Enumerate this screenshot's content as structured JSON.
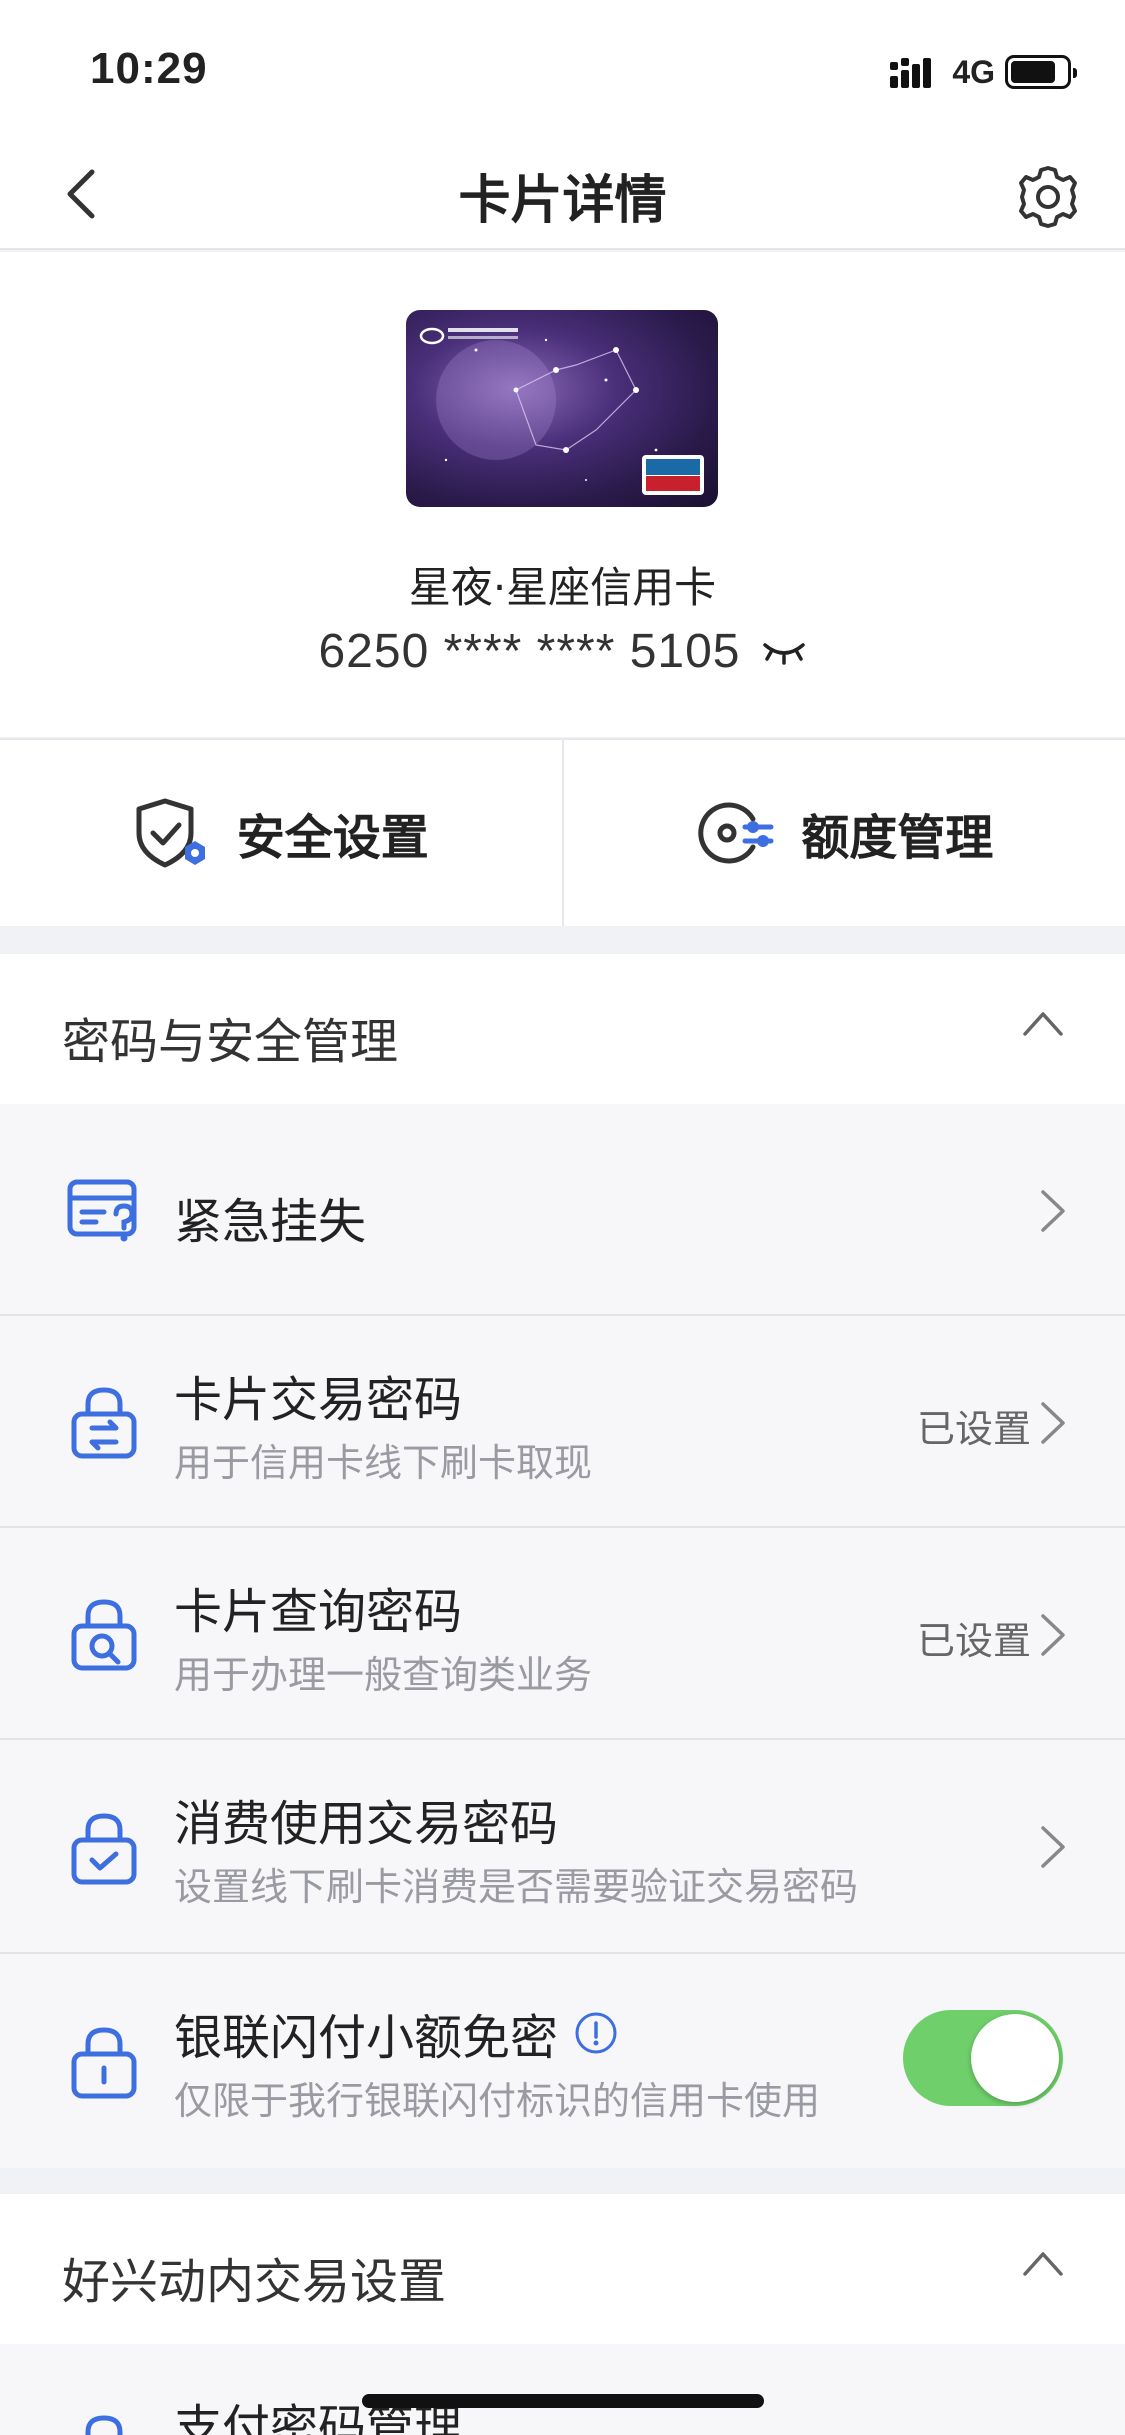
{
  "status_bar": {
    "time": "10:29",
    "network": "4G",
    "battery_level": 0.82
  },
  "nav": {
    "title": "卡片详情"
  },
  "card": {
    "name": "星夜·星座信用卡",
    "number": "6250 **** **** 5105"
  },
  "actions": [
    {
      "label": "安全设置"
    },
    {
      "label": "额度管理"
    }
  ],
  "password_section": {
    "title": "密码与安全管理",
    "items": [
      {
        "title": "紧急挂失"
      },
      {
        "title": "卡片交易密码",
        "subtitle": "用于信用卡线下刷卡取现",
        "status": "已设置"
      },
      {
        "title": "卡片查询密码",
        "subtitle": "用于办理一般查询类业务",
        "status": "已设置"
      },
      {
        "title": "消费使用交易密码",
        "subtitle": "设置线下刷卡消费是否需要验证交易密码"
      },
      {
        "title": "银联闪付小额免密",
        "subtitle": "仅限于我行银联闪付标识的信用卡使用",
        "toggle_on": true
      }
    ]
  },
  "haoxing_section": {
    "title": "好兴动内交易设置",
    "items": [
      {
        "title": "支付密码管理"
      }
    ]
  },
  "colors": {
    "accent": "#3d6fe0",
    "toggle_on": "#6fcf6a",
    "section_gap": "#f1f2f6"
  }
}
